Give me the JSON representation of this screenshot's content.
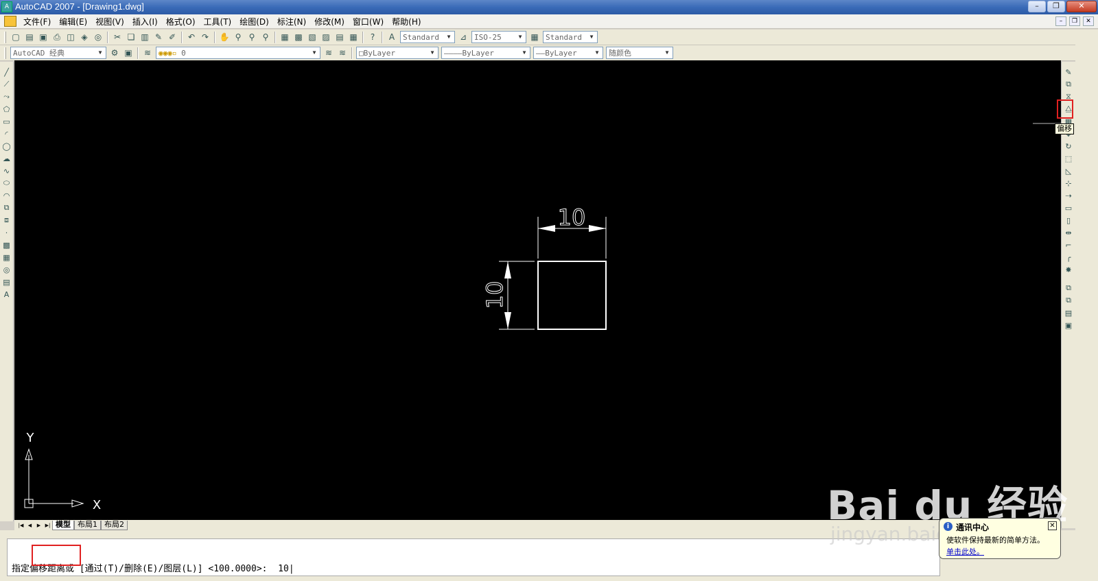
{
  "window": {
    "title": "AutoCAD 2007 - [Drawing1.dwg]"
  },
  "menu": [
    "文件(F)",
    "编辑(E)",
    "视图(V)",
    "插入(I)",
    "格式(O)",
    "工具(T)",
    "绘图(D)",
    "标注(N)",
    "修改(M)",
    "窗口(W)",
    "帮助(H)"
  ],
  "toolbar": {
    "text_style": "Standard",
    "dim_style": "ISO-25",
    "table_style": "Standard",
    "workspace": "AutoCAD 经典",
    "layer": "0",
    "color": "ByLayer",
    "linetype": "ByLayer",
    "lineweight": "ByLayer",
    "plotstyle": "随颜色"
  },
  "tooltip": "偏移",
  "drawing": {
    "dim_horizontal": "10",
    "dim_vertical": "10",
    "ucs_x": "X",
    "ucs_y": "Y"
  },
  "tabs": [
    "模型",
    "布局1",
    "布局2"
  ],
  "command": {
    "prompt": "指定偏移距离或 [通过(T)/删除(E)/图层(L)] <100.0000>:  10"
  },
  "balloon": {
    "title": "通讯中心",
    "text": "使软件保持最新的简单方法。",
    "link": "单击此处。"
  },
  "watermark": {
    "brand": "Bai du 经验",
    "url": "jingyan.baidu.com"
  }
}
